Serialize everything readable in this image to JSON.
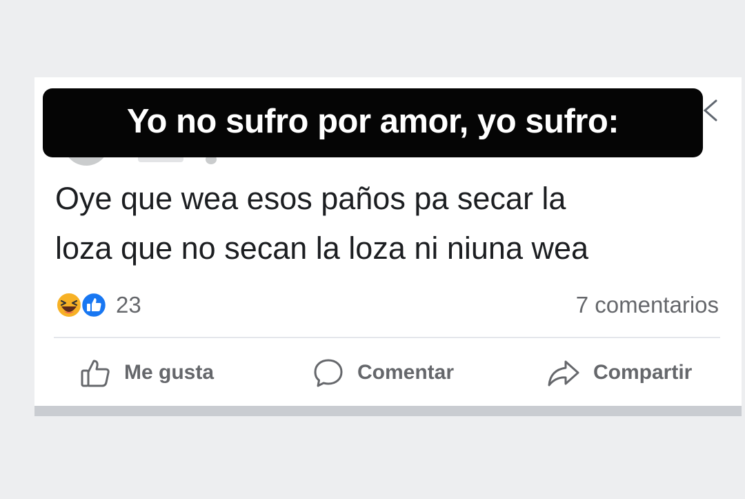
{
  "caption": "Yo no sufro por amor, yo sufro:",
  "post": {
    "text_line1": "Oye que wea esos paños pa secar la",
    "text_line2": "loza que no secan la loza ni niuna wea"
  },
  "reactions": {
    "icons": [
      "laughing-emoji-icon",
      "thumbs-up-like-icon"
    ],
    "count": "23",
    "comments": "7 comentarios"
  },
  "actions": {
    "like": "Me gusta",
    "comment": "Comentar",
    "share": "Compartir"
  },
  "colors": {
    "background": "#edeef0",
    "card": "#ffffff",
    "caption_bg": "#050505",
    "secondary_text": "#65676b",
    "like_blue": "#1877f2",
    "haha_yellow": "#f7b125"
  }
}
